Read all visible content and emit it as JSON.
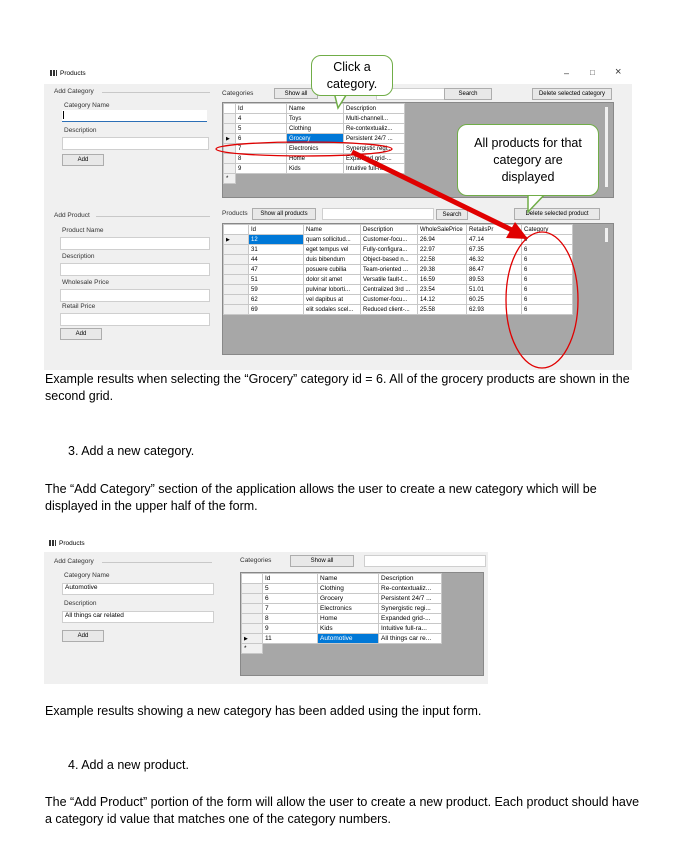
{
  "app": {
    "title": "Products"
  },
  "top_window": {
    "title_bar": {
      "minimize": "–",
      "maximize": "□",
      "close": "×"
    },
    "add_category": {
      "section": "Add Category",
      "name_label": "Category Name",
      "desc_label": "Description",
      "add_button": "Add"
    },
    "add_product": {
      "section": "Add Product",
      "name_label": "Product Name",
      "desc_label": "Description",
      "wholesale_label": "Wholesale Price",
      "retail_label": "Retail Price",
      "add_button": "Add"
    },
    "categories_bar": {
      "label": "Categories",
      "show_all": "Show all",
      "search": "Search",
      "delete": "Delete selected category"
    },
    "products_bar": {
      "label": "Products",
      "show_all": "Show all products",
      "search": "Search",
      "delete": "Delete selected product"
    },
    "categories_grid": {
      "columns": [
        "Id",
        "Name",
        "Description"
      ],
      "rows": [
        [
          "4",
          "Toys",
          "Multi-channell..."
        ],
        [
          "5",
          "Clothing",
          "Re-contextualiz..."
        ],
        [
          "6",
          "Grocery",
          "Persistent 24/7 ..."
        ],
        [
          "7",
          "Electronics",
          "Synergistic regi..."
        ],
        [
          "8",
          "Home",
          "Expanded grid-..."
        ],
        [
          "9",
          "Kids",
          "Intuitive full-ra..."
        ]
      ]
    },
    "products_grid": {
      "columns": [
        "Id",
        "Name",
        "Description",
        "WholeSalePrice",
        "RetailsPr",
        "Category"
      ],
      "rows": [
        [
          "12",
          "quam sollicitud...",
          "Customer-focu...",
          "26.94",
          "47.14",
          "6"
        ],
        [
          "31",
          "eget tempus vel",
          "Fully-configura...",
          "22.97",
          "67.35",
          "6"
        ],
        [
          "44",
          "duis bibendum",
          "Object-based n...",
          "22.58",
          "46.32",
          "6"
        ],
        [
          "47",
          "posuere cubilia",
          "Team-oriented ...",
          "29.38",
          "86.47",
          "6"
        ],
        [
          "51",
          "dolor sit amet",
          "Versatile fault-t...",
          "16.59",
          "89.53",
          "6"
        ],
        [
          "59",
          "pulvinar loborti...",
          "Centralized 3rd ...",
          "23.54",
          "51.01",
          "6"
        ],
        [
          "62",
          "vel dapibus at",
          "Customer-focu...",
          "14.12",
          "60.25",
          "6"
        ],
        [
          "69",
          "elit sodales scel...",
          "Reduced client-...",
          "25.58",
          "62.93",
          "6"
        ]
      ]
    }
  },
  "callouts": {
    "click": "Click a category.",
    "results": "All products for that category are displayed"
  },
  "doc": {
    "caption1": "Example results when selecting the “Grocery” category id = 6.  All of the grocery products are shown in the second grid.",
    "step3": "3.  Add a new category.",
    "para3": "The “Add Category” section of the application allows the user to create a new category which will be displayed in the upper half of the form.",
    "caption2": "Example results showing a new category has been added using the input form.",
    "step4": "4.  Add a new product.",
    "para4": "The “Add Product” portion of the form will allow the user to create a new product.  Each product should have a category id value that matches one of the category numbers."
  },
  "second_window": {
    "title": "Products",
    "add_category": {
      "section": "Add Category",
      "name_label": "Category Name",
      "name_value": "Automotive",
      "desc_label": "Description",
      "desc_value": "All things car related",
      "add_button": "Add"
    },
    "categories_bar": {
      "label": "Categories",
      "show_all": "Show all"
    },
    "grid": {
      "columns": [
        "Id",
        "Name",
        "Description"
      ],
      "rows": [
        [
          "5",
          "Clothing",
          "Re-contextualiz..."
        ],
        [
          "6",
          "Grocery",
          "Persistent 24/7 ..."
        ],
        [
          "7",
          "Electronics",
          "Synergistic regi..."
        ],
        [
          "8",
          "Home",
          "Expanded grid-..."
        ],
        [
          "9",
          "Kids",
          "Intuitive full-ra..."
        ],
        [
          "11",
          "Automotive",
          "All things car re..."
        ]
      ]
    }
  },
  "colors": {
    "selection": "#0078d7",
    "annotation_red": "#e00000",
    "callout_border": "#70ad47"
  }
}
